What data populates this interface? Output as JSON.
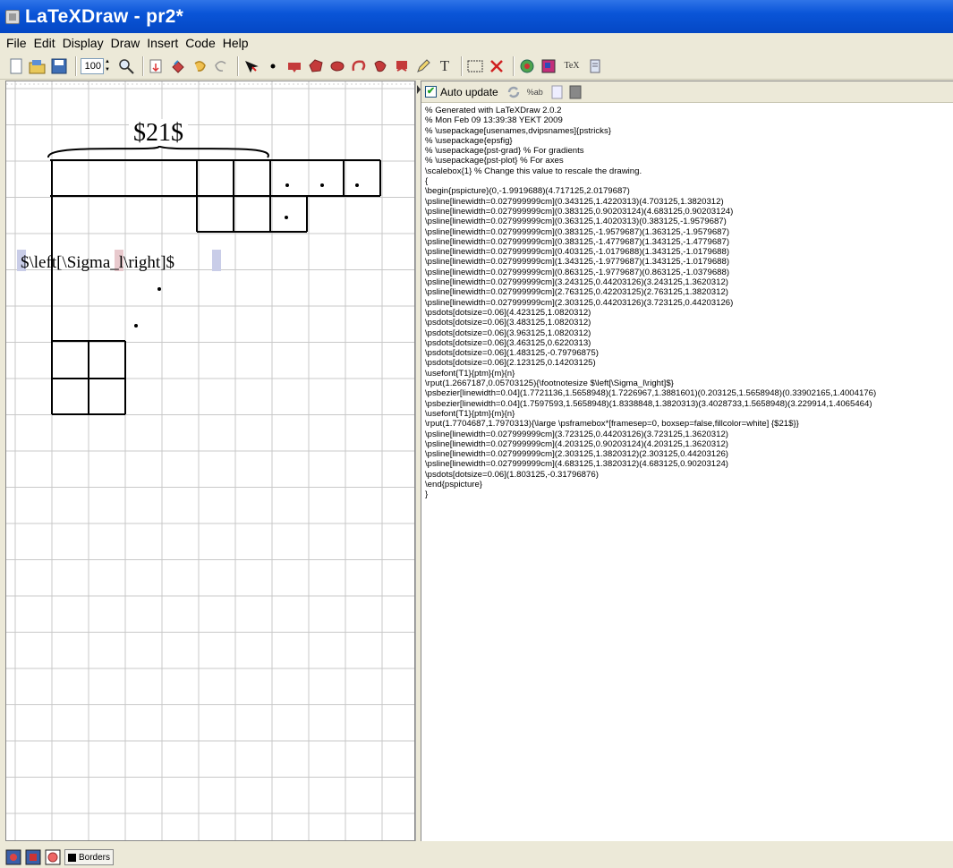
{
  "window": {
    "title": "LaTeXDraw - pr2*"
  },
  "menu": [
    "File",
    "Edit",
    "Display",
    "Draw",
    "Insert",
    "Code",
    "Help"
  ],
  "toolbar": {
    "zoom_value": "100",
    "text_tool_label": "T",
    "tex_label": "TeX"
  },
  "code_toolbar": {
    "auto_update_label": "Auto update",
    "auto_update_checked": true,
    "sab_label": "%ab"
  },
  "canvas": {
    "top_label": "$21$",
    "left_label": "$\\left[\\Sigma_l\\right]$"
  },
  "code": [
    "% Generated with LaTeXDraw 2.0.2",
    "% Mon Feb 09 13:39:38 YEKT 2009",
    "% \\usepackage[usenames,dvipsnames]{pstricks}",
    "% \\usepackage{epsfig}",
    "% \\usepackage{pst-grad} % For gradients",
    "% \\usepackage{pst-plot} % For axes",
    "\\scalebox{1} % Change this value to rescale the drawing.",
    "{",
    "\\begin{pspicture}(0,-1.9919688)(4.717125,2.0179687)",
    "\\psline[linewidth=0.027999999cm](0.343125,1.4220313)(4.703125,1.3820312)",
    "\\psline[linewidth=0.027999999cm](0.383125,0.90203124)(4.683125,0.90203124)",
    "\\psline[linewidth=0.027999999cm](0.363125,1.4020313)(0.383125,-1.9579687)",
    "\\psline[linewidth=0.027999999cm](0.383125,-1.9579687)(1.363125,-1.9579687)",
    "\\psline[linewidth=0.027999999cm](0.383125,-1.4779687)(1.343125,-1.4779687)",
    "\\psline[linewidth=0.027999999cm](0.403125,-1.0179688)(1.343125,-1.0179688)",
    "\\psline[linewidth=0.027999999cm](1.343125,-1.9779687)(1.343125,-1.0179688)",
    "\\psline[linewidth=0.027999999cm](0.863125,-1.9779687)(0.863125,-1.0379688)",
    "\\psline[linewidth=0.027999999cm](3.243125,0.44203126)(3.243125,1.3620312)",
    "\\psline[linewidth=0.027999999cm](2.763125,0.42203125)(2.763125,1.3820312)",
    "\\psline[linewidth=0.027999999cm](2.303125,0.44203126)(3.723125,0.44203126)",
    "\\psdots[dotsize=0.06](4.423125,1.0820312)",
    "\\psdots[dotsize=0.06](3.483125,1.0820312)",
    "\\psdots[dotsize=0.06](3.963125,1.0820312)",
    "\\psdots[dotsize=0.06](3.463125,0.6220313)",
    "\\psdots[dotsize=0.06](1.483125,-0.79796875)",
    "\\psdots[dotsize=0.06](2.123125,0.14203125)",
    "\\usefont{T1}{ptm}{m}{n}",
    "\\rput(1.2667187,0.05703125){\\footnotesize $\\left[\\Sigma_l\\right]$}",
    "\\psbezier[linewidth=0.04](1.7721136,1.5658948)(1.7226967,1.3881601)(0.203125,1.5658948)(0.33902165,1.4004176)",
    "\\psbezier[linewidth=0.04](1.7597593,1.5658948)(1.8338848,1.3820313)(3.4028733,1.5658948)(3.229914,1.4065464)",
    "\\usefont{T1}{ptm}{m}{n}",
    "\\rput(1.7704687,1.7970313){\\large \\psframebox*[framesep=0, boxsep=false,fillcolor=white] {$21$}}",
    "\\psline[linewidth=0.027999999cm](3.723125,0.44203126)(3.723125,1.3620312)",
    "\\psline[linewidth=0.027999999cm](4.203125,0.90203124)(4.203125,1.3620312)",
    "\\psline[linewidth=0.027999999cm](2.303125,1.3820312)(2.303125,0.44203126)",
    "\\psline[linewidth=0.027999999cm](4.683125,1.3820312)(4.683125,0.90203124)",
    "\\psdots[dotsize=0.06](1.803125,-0.31796876)",
    "\\end{pspicture}",
    "}"
  ],
  "statusbar": {
    "borders_label": "Borders"
  },
  "colors": {
    "titlebar": "#0a55d8",
    "chrome": "#ece9d8",
    "grid": "#c8c8c8"
  }
}
